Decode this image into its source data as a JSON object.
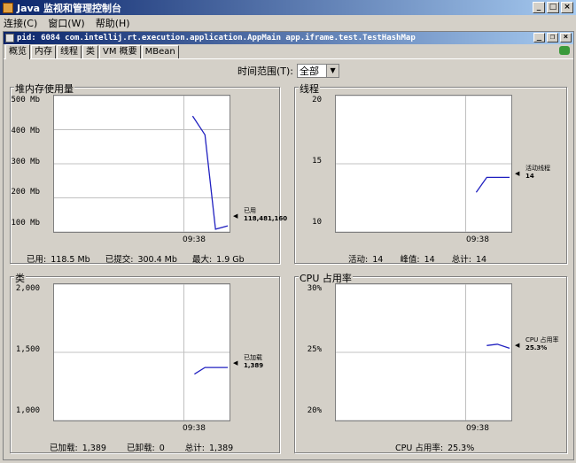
{
  "window": {
    "title": "Java 监视和管理控制台"
  },
  "menu": [
    "连接(C)",
    "窗口(W)",
    "帮助(H)"
  ],
  "inner": {
    "title": "pid: 6084 com.intellij.rt.execution.application.AppMain app.iframe.test.TestHashMap"
  },
  "tabs": [
    "概览",
    "内存",
    "线程",
    "类",
    "VM 概要",
    "MBean"
  ],
  "time_range": {
    "label": "时间范围(T):",
    "value": "全部"
  },
  "panels": {
    "heap": {
      "title": "堆内存使用量",
      "yticks": [
        "500 Mb",
        "400 Mb",
        "300 Mb",
        "200 Mb",
        "100 Mb"
      ],
      "xtick": "09:38",
      "legend_label": "已用",
      "legend_value": "118,481,160",
      "footer": {
        "used_label": "已用:",
        "used": "118.5  Mb",
        "committed_label": "已提交:",
        "committed": "300.4  Mb",
        "max_label": "最大:",
        "max": "1.9  Gb"
      },
      "series": [
        440,
        385,
        108,
        118
      ]
    },
    "threads": {
      "title": "线程",
      "yticks": [
        "20",
        "15",
        "10"
      ],
      "xtick": "09:38",
      "legend_label": "活动线程",
      "legend_value": "14",
      "footer": {
        "live_label": "活动:",
        "live": "14",
        "peak_label": "峰值:",
        "peak": "14",
        "total_label": "总计:",
        "total": "14"
      },
      "series": [
        12.9,
        14,
        14,
        14
      ]
    },
    "classes": {
      "title": "类",
      "yticks": [
        "2,000",
        "1,500",
        "1,000"
      ],
      "xtick": "09:38",
      "legend_label": "已加载",
      "legend_value": "1,389",
      "footer": {
        "loaded_label": "已加载:",
        "loaded": "1,389",
        "unloaded_label": "已卸载:",
        "unloaded": "0",
        "total_label": "总计:",
        "total": "1,389"
      },
      "series": [
        1340,
        1389,
        1389,
        1389
      ]
    },
    "cpu": {
      "title": "CPU 占用率",
      "yticks": [
        "30%",
        "25%",
        "20%"
      ],
      "xtick": "09:38",
      "legend_label": "CPU 占用率",
      "legend_value": "25.3%",
      "footer": {
        "cpu_label": "CPU 占用率:",
        "cpu": "25.3%"
      },
      "series": [
        25.5,
        25.6,
        25.3
      ]
    }
  },
  "colors": {
    "line": "#2020c0",
    "grid": "#c0c0c0"
  }
}
